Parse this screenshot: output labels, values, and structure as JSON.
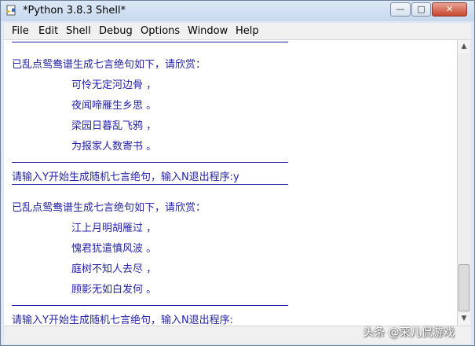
{
  "window": {
    "title": "*Python 3.8.3 Shell*",
    "controls": {
      "minimize": "—",
      "maximize": "□",
      "close": "✕"
    }
  },
  "menubar": {
    "items": [
      {
        "label": "File"
      },
      {
        "label": "Edit"
      },
      {
        "label": "Shell"
      },
      {
        "label": "Debug"
      },
      {
        "label": "Options"
      },
      {
        "label": "Window"
      },
      {
        "label": "Help"
      }
    ]
  },
  "shell": {
    "block1": {
      "intro": "已乱点鸳鸯谱生成七言绝句如下，请欣赏：",
      "poem": [
        "可怜无定河边骨 ，",
        "夜闻啼雁生乡思 。",
        "梁园日暮乱飞鸦 ，",
        "为报家人数寄书 。"
      ]
    },
    "prompt1": "请输入Y开始生成随机七言绝句，输入N退出程序:y",
    "block2": {
      "intro": "已乱点鸳鸯谱生成七言绝句如下，请欣赏：",
      "poem": [
        "江上月明胡雁过 ，",
        "愧君犹遣慎风波 。",
        "庭树不知人去尽 ，",
        "顾影无如白发何 。"
      ]
    },
    "prompt2": "请输入Y开始生成随机七言绝句，输入N退出程序:"
  },
  "watermark": "头条 @荣儿侃游戏",
  "colors": {
    "shell_text": "#2424a8",
    "title_bg": "#c7d8ee"
  }
}
